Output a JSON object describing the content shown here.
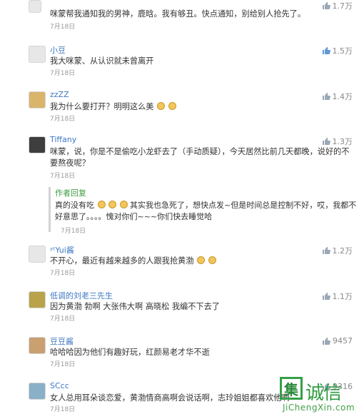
{
  "comments": [
    {
      "name": "",
      "likes": "1.7万",
      "text": "咪蒙帮我通知我的男神，鹿晗。我有够丑。快点通知，别给别人抢先了。",
      "date": "7月18日"
    },
    {
      "name": "小豆",
      "likes": "1.5万",
      "text": "我大咪蒙、从认识就未曾离开",
      "date": "7月18日"
    },
    {
      "name": "zzZZ",
      "likes": "1.4万",
      "text": "我为什么要打开？明明这么美",
      "date": "7月18日"
    },
    {
      "name": "Tiffany",
      "likes": "1.3万",
      "text": "咪蒙，说，你是不是偷吃小龙虾去了（手动质疑），今天居然比前几天都晚，说好的不要熬夜呢？",
      "date": "7月18日"
    },
    {
      "name": "ʸᵗYui酱",
      "likes": "1.2万",
      "text": "不开心，最近有越来越多的人跟我抢黄渤",
      "date": "7月18日"
    },
    {
      "name": "低调的刘老三先生",
      "likes": "1.1万",
      "text": "因为黄渤 勃啊 大张伟大啊   高晓松   我编不下去了",
      "date": "7月18日"
    },
    {
      "name": "豆豆酱",
      "likes": "9457",
      "text": "哈哈哈因为他们有趣好玩，红颜易老才华不逝",
      "date": "7月18日"
    },
    {
      "name": "SCcc",
      "likes": "9316",
      "text": "女人总用耳朵谈恋爱，黄渤情商高啊会说话啊，志玲姐姐都喜欢他啊",
      "date": "7月18日"
    }
  ],
  "reply": {
    "author": "作者回复",
    "text_a": "真的没有吃",
    "text_b": "其实我也急死了，想快点发~但是时间总是控制不好，哎，我都不好意思了。。。。愧对你们~~~你们快去睡觉哈",
    "date": "7月18日"
  },
  "watermark": {
    "box_char": "集",
    "chars": "诚信",
    "url": "JiChengXin.com"
  }
}
